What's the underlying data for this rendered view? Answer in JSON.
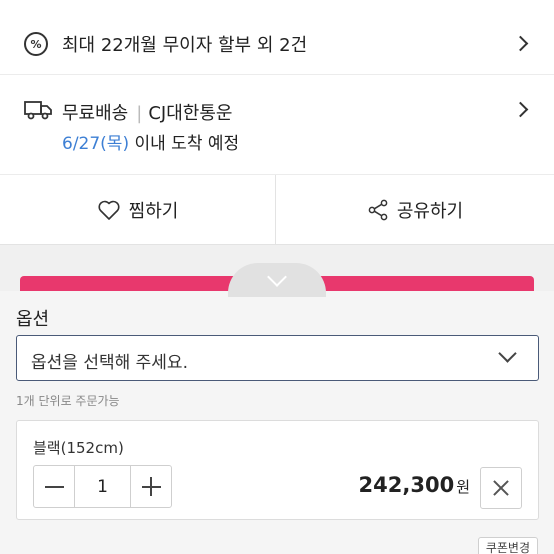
{
  "installment": {
    "icon": "percent-icon",
    "text": "최대 22개월 무이자 할부 외 2건"
  },
  "delivery": {
    "icon": "truck-icon",
    "shipping": "무료배송",
    "courier": "CJ대한통운",
    "date": "6/27(목)",
    "eta_suffix": " 이내 도착 예정"
  },
  "actions": {
    "like_label": "찜하기",
    "share_label": "공유하기"
  },
  "options": {
    "title": "옵션",
    "select_placeholder": "옵션을 선택해 주세요.",
    "unit_note": "1개 단위로 주문가능"
  },
  "selected_item": {
    "name": "블랙(152cm)",
    "quantity": "1",
    "price": "242,300",
    "currency": "원"
  },
  "coupon": {
    "label": "쿠폰변경"
  },
  "colors": {
    "accent_pink": "#e8386d",
    "link_blue": "#3d7fd4"
  }
}
